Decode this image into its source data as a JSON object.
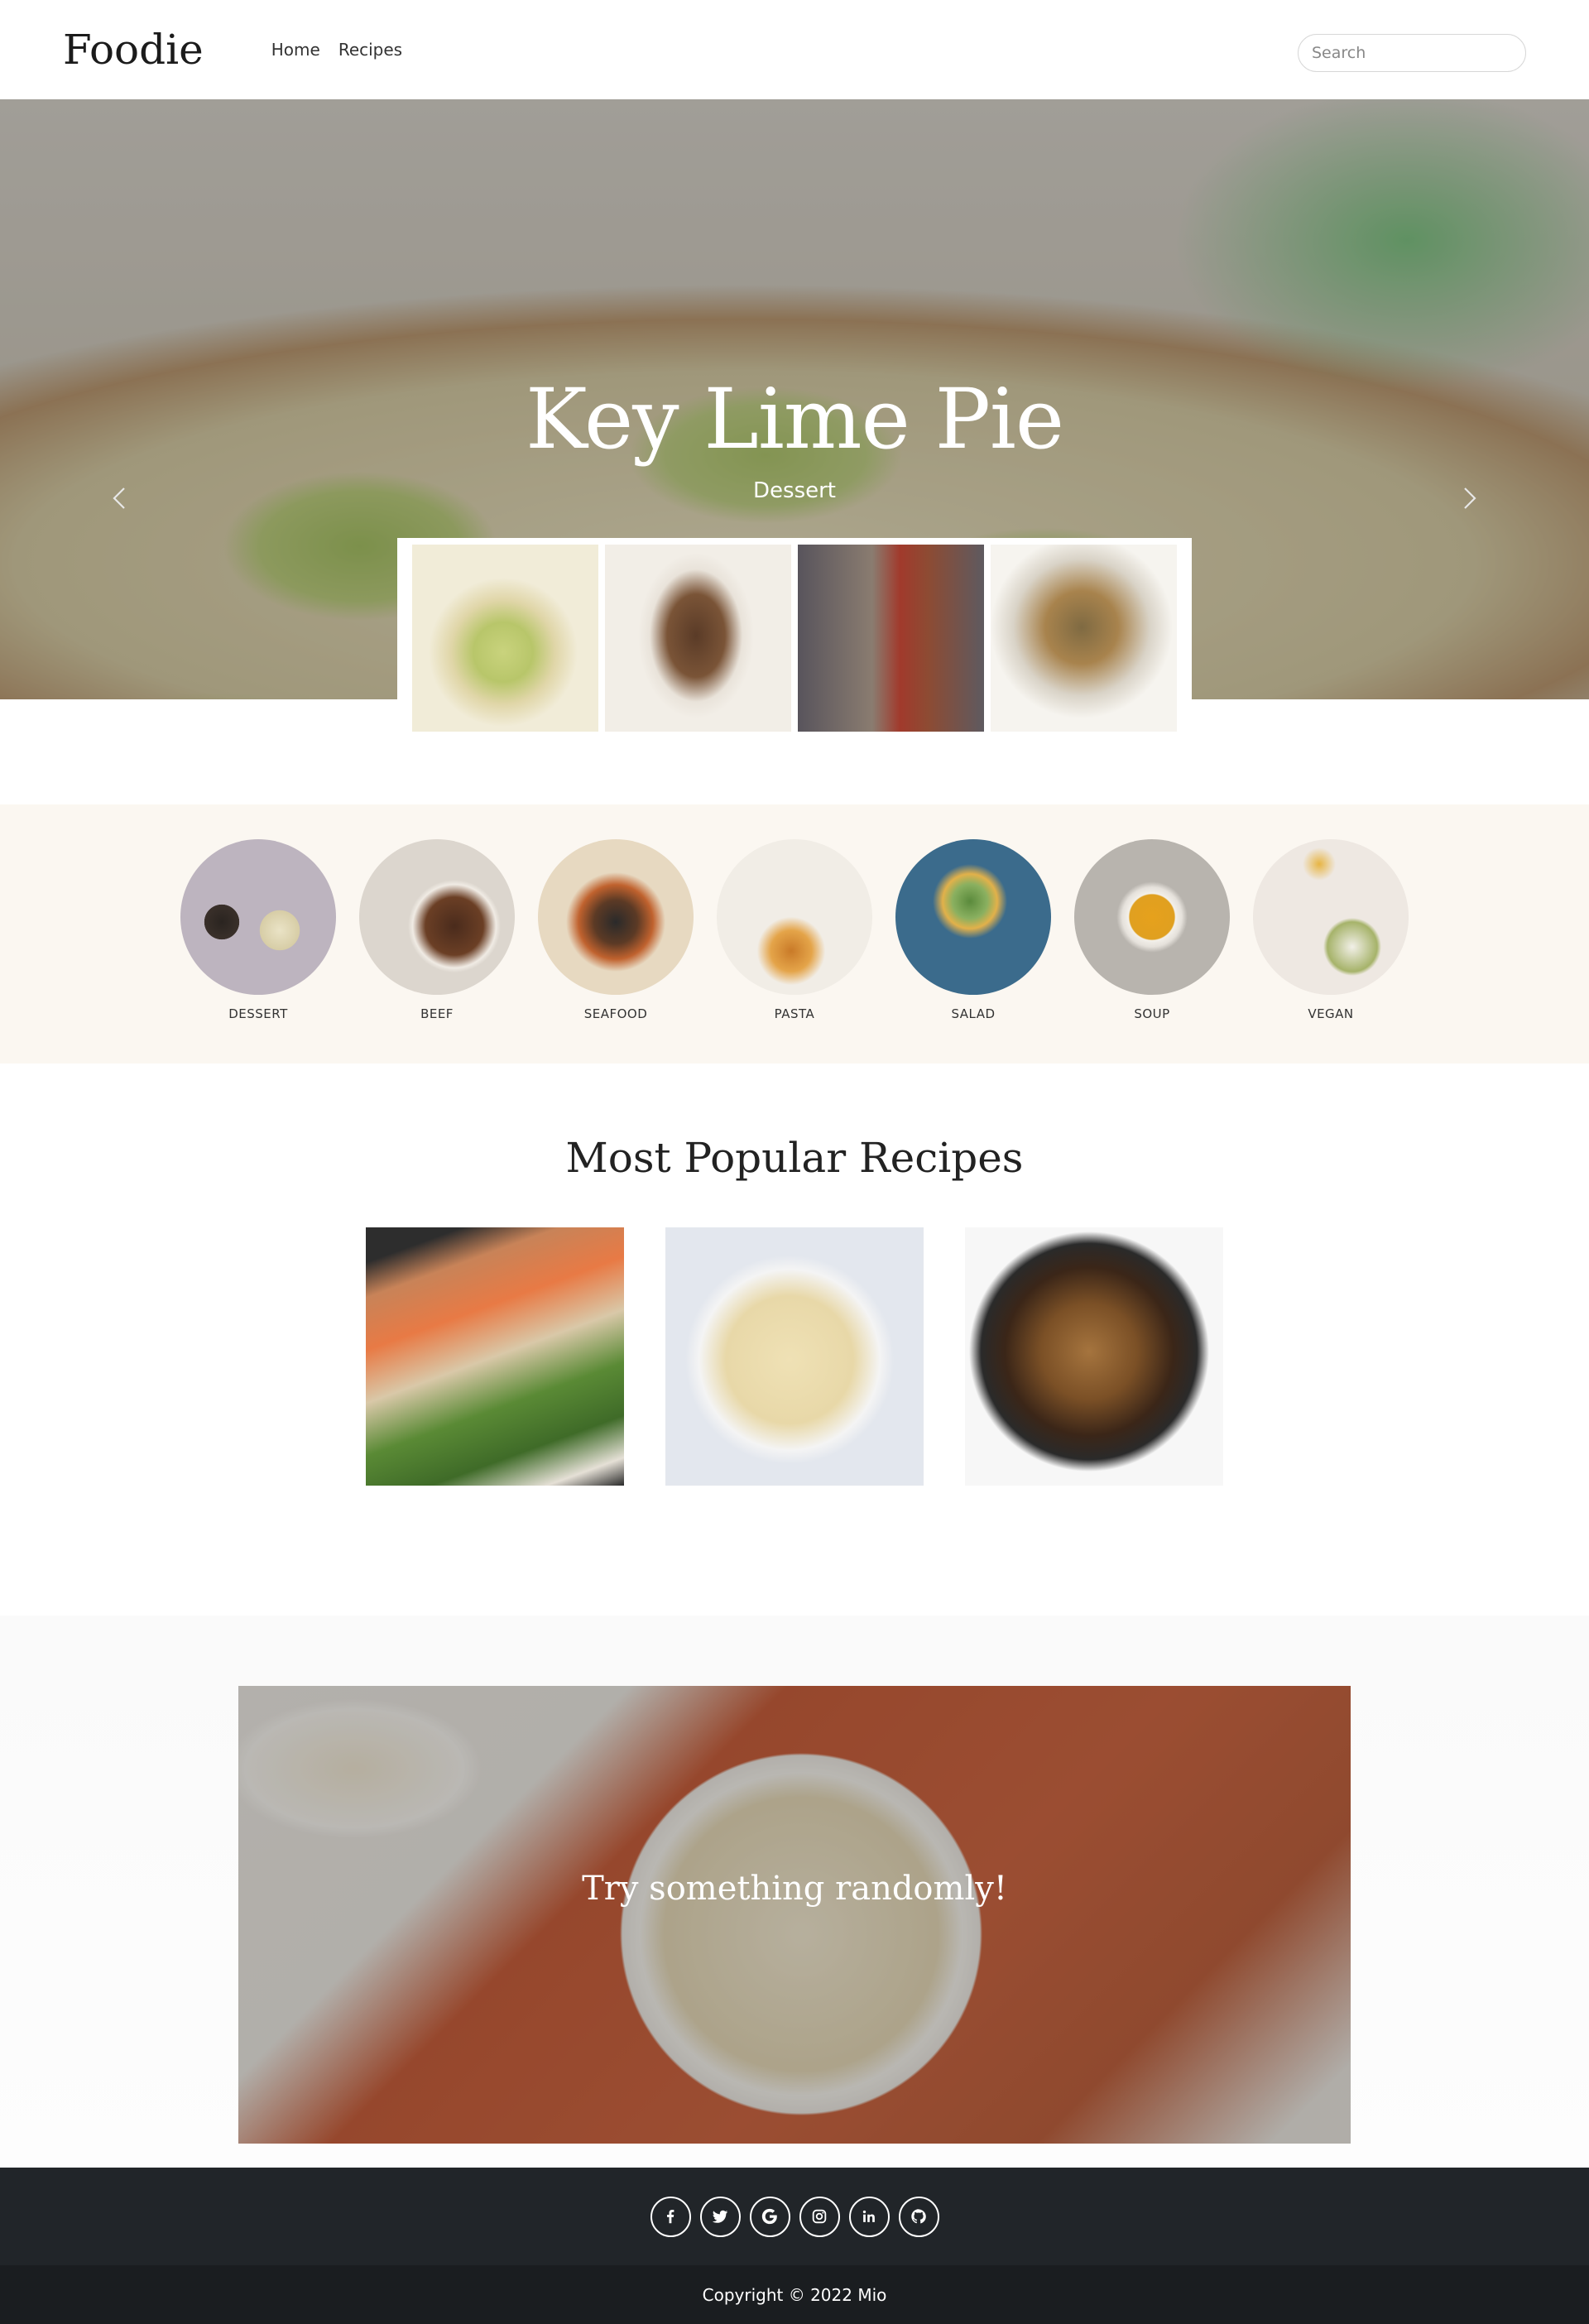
{
  "navbar": {
    "brand": "Foodie",
    "links": [
      "Home",
      "Recipes"
    ],
    "search_placeholder": "Search"
  },
  "hero": {
    "title": "Key Lime Pie",
    "subtitle": "Dessert",
    "prev_icon": "chevron-left-icon",
    "next_icon": "chevron-right-icon"
  },
  "categories": [
    "DESSERT",
    "BEEF",
    "SEAFOOD",
    "PASTA",
    "SALAD",
    "SOUP",
    "VEGAN"
  ],
  "popular": {
    "title": "Most Popular Recipes"
  },
  "random": {
    "text": "Try something randomly!"
  },
  "footer": {
    "social_icons": [
      "facebook-icon",
      "twitter-icon",
      "google-icon",
      "instagram-icon",
      "linkedin-icon",
      "github-icon"
    ],
    "copyright": "Copyright © 2022 Mio"
  }
}
